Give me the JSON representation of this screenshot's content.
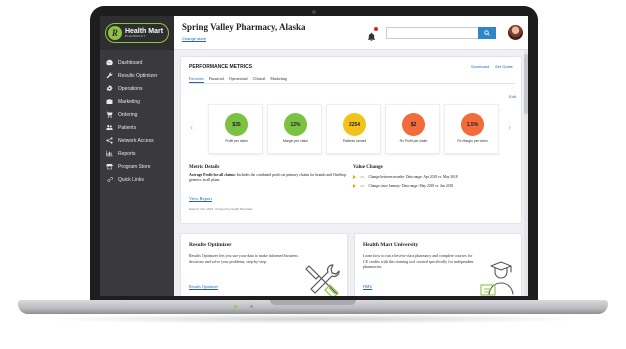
{
  "brand": {
    "logo_name": "Health Mart",
    "logo_sub": "PHARMACY",
    "accent": "#8fc33f",
    "link_color": "#1a67b8"
  },
  "sidebar": {
    "items": [
      {
        "label": "Dashboard",
        "icon": "dashboard-icon"
      },
      {
        "label": "Results Optimizer",
        "icon": "wrench-icon"
      },
      {
        "label": "Operations",
        "icon": "gear-icon"
      },
      {
        "label": "Marketing",
        "icon": "briefcase-icon"
      },
      {
        "label": "Ordering",
        "icon": "cart-icon"
      },
      {
        "label": "Patients",
        "icon": "people-icon"
      },
      {
        "label": "Network Access",
        "icon": "share-icon"
      },
      {
        "label": "Reports",
        "icon": "chart-icon"
      },
      {
        "label": "Program Store",
        "icon": "store-icon"
      },
      {
        "label": "Quick Links",
        "icon": "link-icon"
      }
    ]
  },
  "header": {
    "title": "Spring Valley Pharmacy, Alaska",
    "change_store": "Change store",
    "search_placeholder": ""
  },
  "performance": {
    "title": "PERFORMANCE METRICS",
    "scorecard_link": "Scorecard",
    "set_goals_link": "Set Goals",
    "tabs": [
      "Favorites",
      "Financial",
      "Operational",
      "Clinical",
      "Marketing"
    ],
    "edit_link": "Edit",
    "metrics": [
      {
        "value": "$35",
        "label": "Profit per claim",
        "color": "#7cc242"
      },
      {
        "value": "12%",
        "label": "Margin per claim",
        "color": "#7cc242"
      },
      {
        "value": "2254",
        "label": "Patients served",
        "color": "#f2c21b"
      },
      {
        "value": "$2",
        "label": "Rx Profit per claim",
        "color": "#f26b3a"
      },
      {
        "value": "1.5%",
        "label": "Rx Margin per claim",
        "color": "#f26b3a"
      }
    ],
    "metric_details": {
      "title": "Metric Details",
      "bold_text": "Average Profit for all claims:",
      "text": " Includes the combined profit on primary claims for brands and OneStop generics in all plans.",
      "view_report": "View Report",
      "footnote": "Data for: Nov, 2018 · Powered by Health Mart Atlas"
    },
    "value_change": {
      "title": "Value Change",
      "rows": [
        {
          "pct": "4%",
          "text": "Change between months- Data range: Apr 2018 vs. May 2018"
        },
        {
          "pct": "4%",
          "text": "Change since January- Data range: May 2018 vs. Jun 2018"
        }
      ]
    }
  },
  "results_optimizer": {
    "title": "Results Optimizer",
    "body": "Results Optimizer lets you use your data to make informed business decisions and solve your problems, step-by-step.",
    "link": "Results Optimizer"
  },
  "hmu": {
    "title": "Health Mart University",
    "body": "Learn how to run a best-in-class pharmacy and complete courses for CE credits with this training tool created specifically for independent pharmacies.",
    "link": "HMU"
  }
}
